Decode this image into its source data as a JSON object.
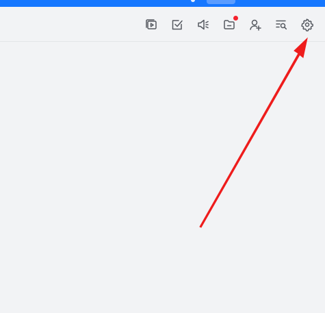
{
  "colors": {
    "topbar": "#1677ff",
    "background": "#f2f3f5",
    "icon": "#54585f",
    "badge": "#f5222d",
    "arrow": "#ee1c1c"
  },
  "toolbar": {
    "icons": [
      {
        "name": "video-library-icon"
      },
      {
        "name": "task-checkbox-icon"
      },
      {
        "name": "announcement-speaker-icon"
      },
      {
        "name": "folder-icon",
        "badge": true
      },
      {
        "name": "add-contact-icon"
      },
      {
        "name": "search-list-icon"
      },
      {
        "name": "settings-gear-icon"
      }
    ]
  }
}
